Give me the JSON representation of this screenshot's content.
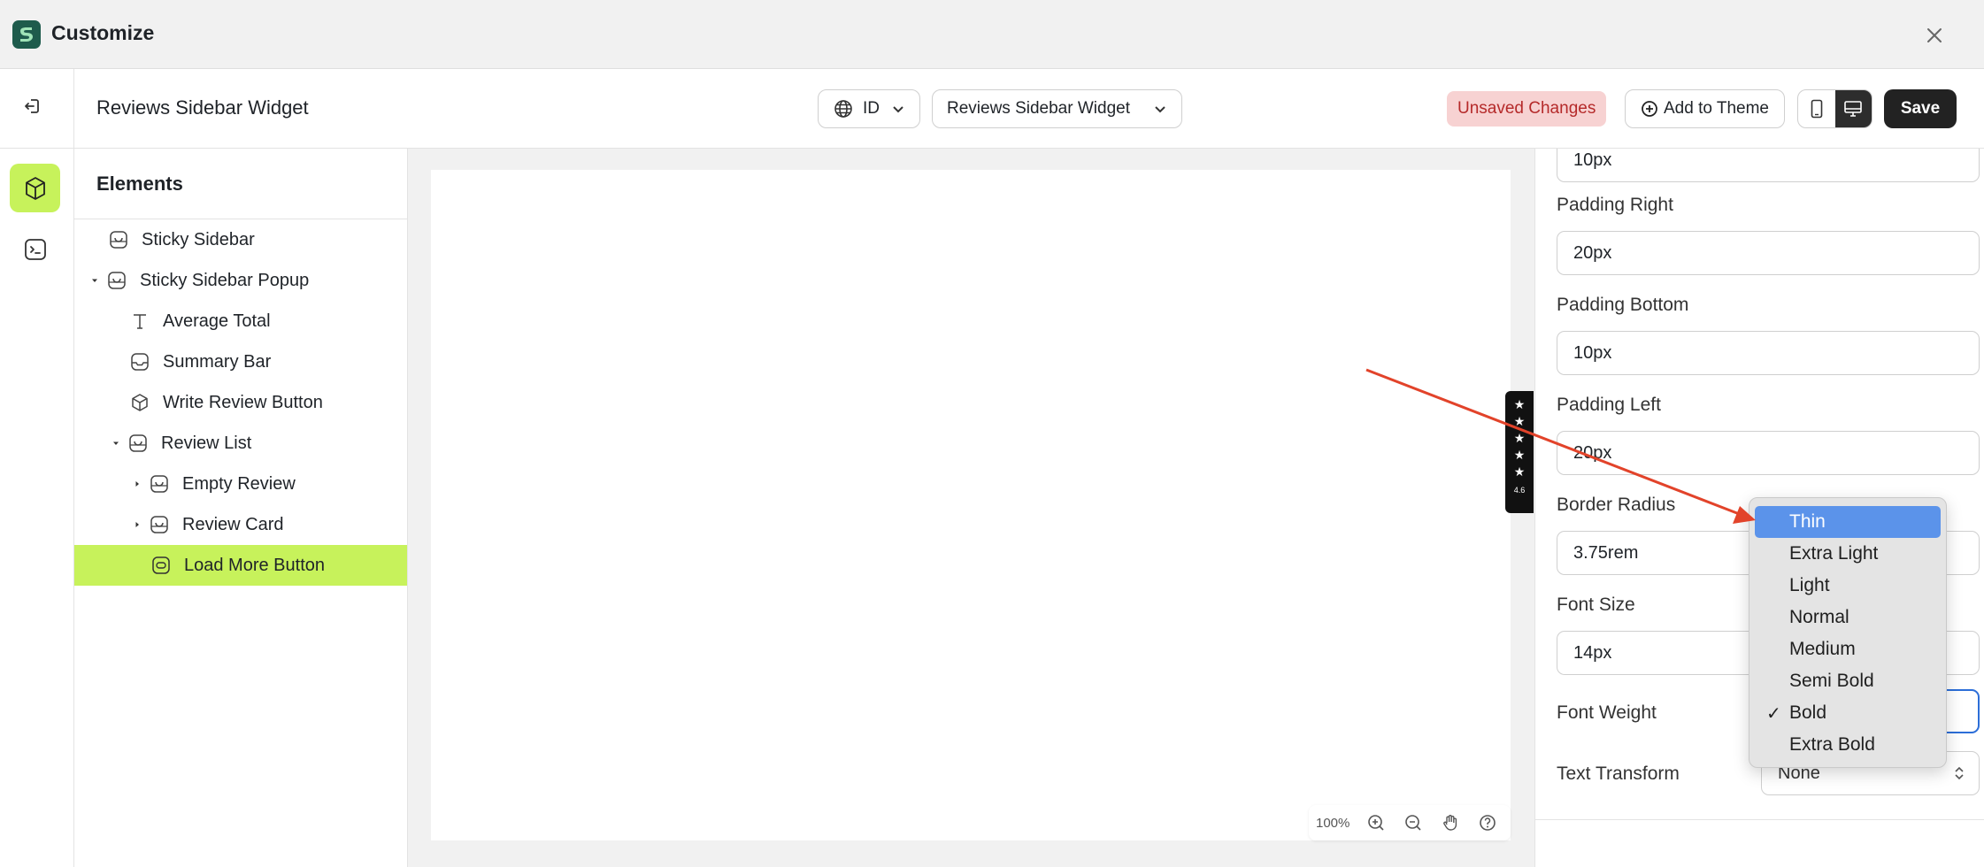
{
  "app": {
    "title": "Customize",
    "close_icon": "close-icon"
  },
  "header": {
    "page_title": "Reviews Sidebar Widget",
    "language": "ID",
    "widget_select": "Reviews Sidebar Widget",
    "unsaved": "Unsaved Changes",
    "add_to_theme": "Add to Theme",
    "save": "Save",
    "active_device": "desktop"
  },
  "elements_panel": {
    "title": "Elements",
    "items": [
      {
        "label": "Sticky Sidebar",
        "icon": "section-icon"
      },
      {
        "label": "Sticky Sidebar Popup",
        "icon": "section-icon",
        "expanded": true
      },
      {
        "label": "Average Total",
        "icon": "text-icon"
      },
      {
        "label": "Summary Bar",
        "icon": "container-icon"
      },
      {
        "label": "Write Review Button",
        "icon": "cube-icon"
      },
      {
        "label": "Review List",
        "icon": "section-icon",
        "expanded": true
      },
      {
        "label": "Empty Review",
        "icon": "section-icon",
        "expanded": false
      },
      {
        "label": "Review Card",
        "icon": "section-icon",
        "expanded": false
      },
      {
        "label": "Load More Button",
        "icon": "button-element-icon",
        "selected": true
      }
    ]
  },
  "canvas": {
    "rating_score": "4.6",
    "zoom": "100%"
  },
  "properties": {
    "padding_top_value": "10px",
    "padding_right_label": "Padding Right",
    "padding_right_value": "20px",
    "padding_bottom_label": "Padding Bottom",
    "padding_bottom_value": "10px",
    "padding_left_label": "Padding Left",
    "padding_left_value": "20px",
    "border_radius_label": "Border Radius",
    "border_radius_value": "3.75rem",
    "font_size_label": "Font Size",
    "font_size_value": "14px",
    "font_weight_label": "Font Weight",
    "text_transform_label": "Text Transform",
    "text_transform_value": "None"
  },
  "font_weight_dropdown": {
    "options": [
      "Thin",
      "Extra Light",
      "Light",
      "Normal",
      "Medium",
      "Semi Bold",
      "Bold",
      "Extra Bold"
    ],
    "highlighted": "Thin",
    "selected": "Bold"
  },
  "colors": {
    "accent_lime": "#c7f25b",
    "save_dark": "#222222",
    "unsaved_bg": "#f7d2d2",
    "unsaved_text": "#b52a2a",
    "dropdown_highlight": "#5b93ea",
    "annotation_arrow": "#e2432a"
  }
}
